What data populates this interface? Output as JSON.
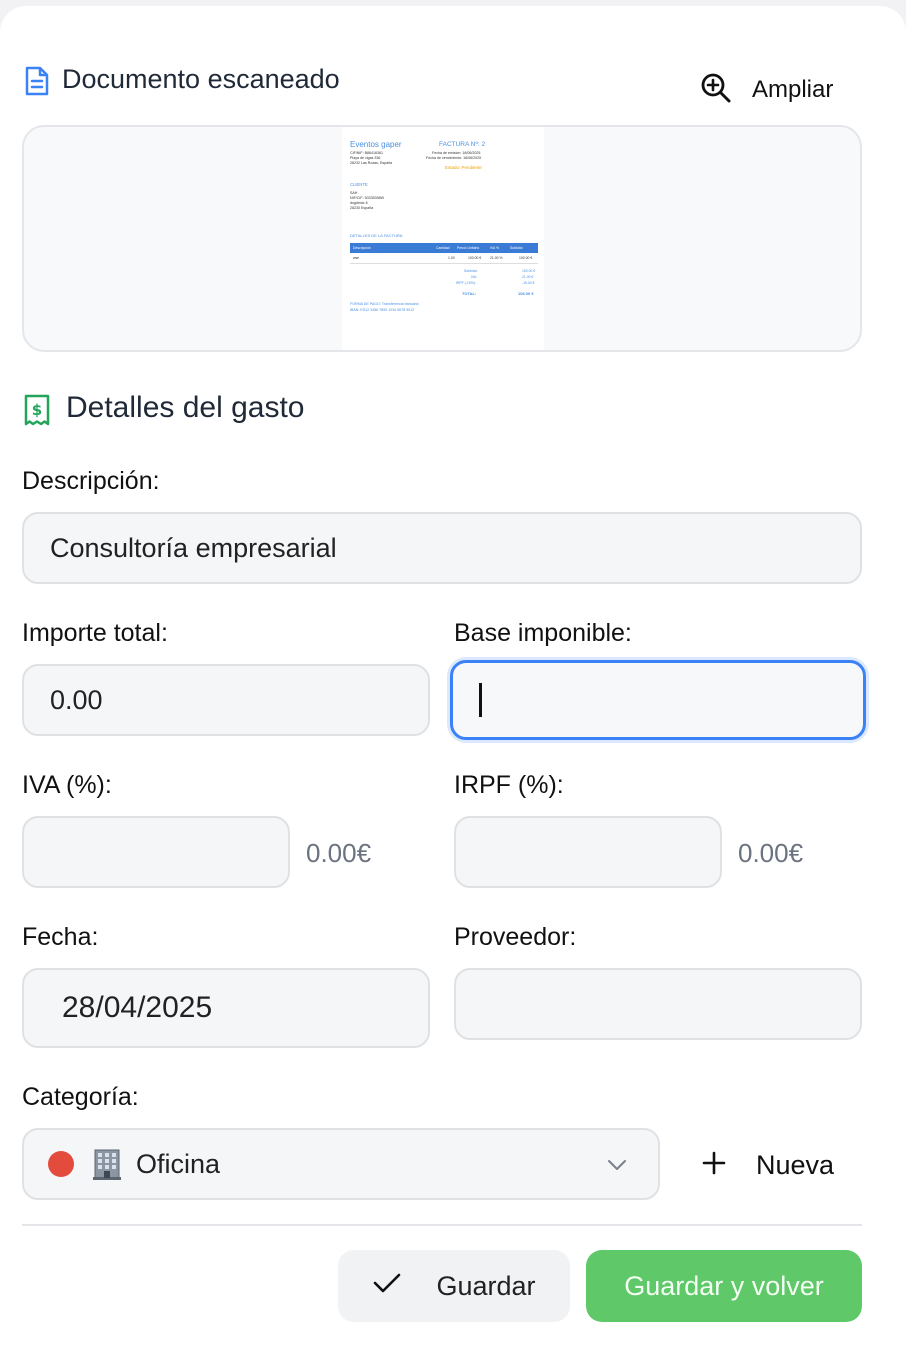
{
  "scanned": {
    "title": "Documento escaneado",
    "zoom_label": "Ampliar",
    "preview": {
      "company": "Eventos gaper",
      "invoice_no": "FACTURA Nº: 2",
      "company_lines": [
        "CIF/NIF: B86416361",
        "Playa de vigas 336",
        "28232 Las Rozas, España"
      ],
      "date_lines": [
        "Fecha de emisión: 16/06/2025",
        "Fecha de vencimiento: 16/06/2025"
      ],
      "status": "Estado: Pendiente",
      "client_heading": "CLIENTE",
      "client_lines": [
        "SAH",
        "NIF/CIF: 50335398W",
        "dxgdmdc 6",
        "28230  España"
      ],
      "details_heading": "DETALLES DE LA FACTURA",
      "table_headers": [
        "Descripción",
        "Cantidad",
        "Precio Unitario",
        "IVA %",
        "Subtotal"
      ],
      "table_row": [
        "wse",
        "1.00",
        "100.00 €",
        "21.00 %",
        "100.00 €"
      ],
      "totals": [
        {
          "label": "Subtotal:",
          "value": "100.00 €"
        },
        {
          "label": "IVA:",
          "value": "21.00 €"
        },
        {
          "label": "IRPF (-15%):",
          "value": "-15.00 €"
        }
      ],
      "total_label": "TOTAL:",
      "total_value": "106.00 €",
      "payment_lines": [
        "FORMA DE PAGO: Transferencia bancaria",
        "IBAN: ES12 3456 7890 1234 5678 9012"
      ]
    }
  },
  "details": {
    "title": "Detalles del gasto",
    "description_label": "Descripción:",
    "description_value": "Consultoría empresarial",
    "total_label": "Importe total:",
    "total_value": "0.00",
    "base_label": "Base imponible:",
    "base_value": "",
    "iva_label": "IVA (%):",
    "iva_value": "",
    "iva_amount": "0.00€",
    "irpf_label": "IRPF (%):",
    "irpf_value": "",
    "irpf_amount": "0.00€",
    "date_label": "Fecha:",
    "date_value": "28/04/2025",
    "supplier_label": "Proveedor:",
    "supplier_value": "",
    "category_label": "Categoría:",
    "category_value": "Oficina",
    "category_color": "#e34b3c",
    "new_label": "Nueva"
  },
  "actions": {
    "save_label": "Guardar",
    "save_back_label": "Guardar y volver",
    "save_back_color": "#5fc868"
  }
}
